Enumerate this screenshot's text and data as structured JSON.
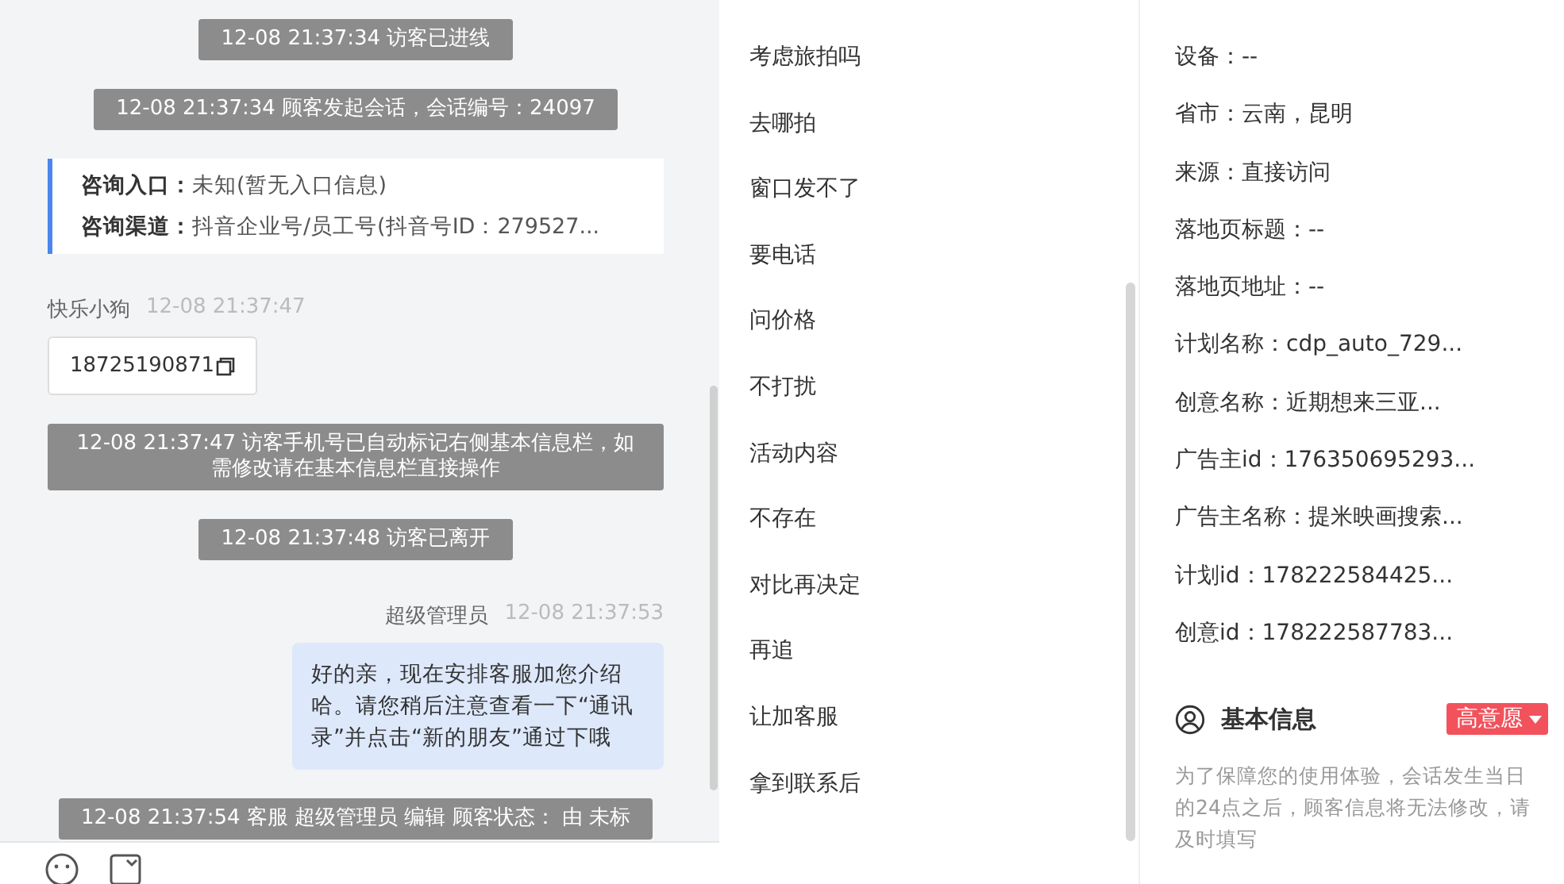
{
  "chat": {
    "messages": [
      {
        "kind": "system",
        "text": "12-08 21:37:34 访客已进线"
      },
      {
        "kind": "system",
        "text": "12-08 21:37:34 顾客发起会话，会话编号：24097"
      },
      {
        "kind": "info",
        "rows": [
          {
            "label": "咨询入口：",
            "value": "未知(暂无入口信息)"
          },
          {
            "label": "咨询渠道：",
            "value": "抖音企业号/员工号(抖音号ID：279527..."
          }
        ]
      },
      {
        "kind": "customer",
        "sender": "快乐小狗",
        "time": "12-08 21:37:47",
        "text": "18725190871"
      },
      {
        "kind": "system",
        "text": "12-08 21:37:47 访客手机号已自动标记右侧基本信息栏，如需修改请在基本信息栏直接操作"
      },
      {
        "kind": "system",
        "text": "12-08 21:37:48 访客已离开"
      },
      {
        "kind": "agent",
        "sender": "超级管理员",
        "time": "12-08 21:37:53",
        "text": "好的亲，现在安排客服加您介绍哈。请您稍后注意查看一下“通讯录”并点击“新的朋友”通过下哦"
      },
      {
        "kind": "system",
        "text": "12-08 21:37:54 客服 超级管理员 编辑 顾客状态： 由 未标"
      }
    ]
  },
  "quick_replies": [
    "考虑旅拍吗",
    "去哪拍",
    "窗口发不了",
    "要电话",
    "问价格",
    "不打扰",
    "活动内容",
    "不存在",
    "对比再决定",
    "再追",
    "让加客服",
    "拿到联系后"
  ],
  "visitor_info": [
    "设备：--",
    "省市：云南，昆明",
    "来源：直接访问",
    "落地页标题：--",
    "落地页地址：--",
    "计划名称：cdp_auto_729...",
    "创意名称：近期想来三亚...",
    "广告主id：176350695293...",
    "广告主名称：提米映画搜索...",
    "计划id：178222584425...",
    "创意id：178222587783..."
  ],
  "basic_info": {
    "title": "基本信息",
    "intent_tag": "高意愿",
    "note": "为了保障您的使用体验，会话发生当日的24点之后，顾客信息将无法修改，请及时填写"
  }
}
